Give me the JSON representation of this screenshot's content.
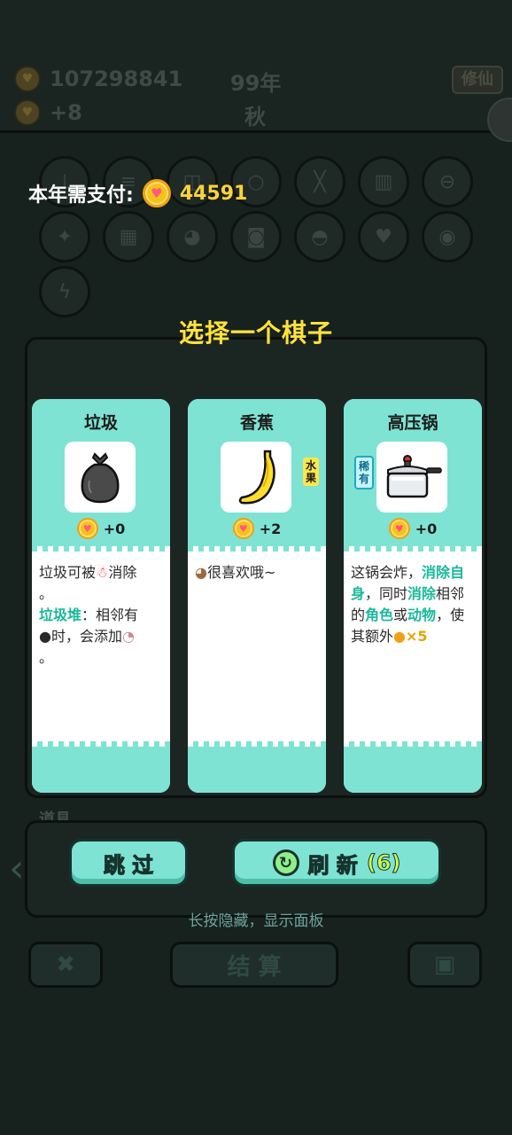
{
  "header": {
    "gold": "107298841",
    "income": "+8",
    "year": "99年",
    "season": "秋",
    "xiuxian_label": "修仙"
  },
  "overlay": {
    "pay_label": "本年需支付:",
    "pay_amount": "44591",
    "choose_title": "选择一个棋子",
    "hint": "长按隐藏，显示面板"
  },
  "cards": [
    {
      "title": "垃圾",
      "item_icon": "garbage-bag-icon",
      "value": "+0",
      "desc_line1_a": "垃圾可被",
      "desc_line1_b": "消除",
      "desc_line1_c": "。",
      "desc_line2_hl": "垃圾堆",
      "desc_line2_a": "：相邻有",
      "desc_line2_b": "时，会添加",
      "desc_line2_c": "。"
    },
    {
      "title": "香蕉",
      "item_icon": "banana-icon",
      "value": "+2",
      "tag": "水果",
      "desc": "很喜欢哦~"
    },
    {
      "title": "高压锅",
      "item_icon": "pressure-cooker-icon",
      "value": "+0",
      "tag": "稀有",
      "desc_a": "这锅会炸，",
      "desc_b": "消除自身",
      "desc_c": "，同时",
      "desc_d": "消除",
      "desc_e": "相邻的",
      "desc_f": "角色",
      "desc_g": "或",
      "desc_h": "动物",
      "desc_i": "，使其额外",
      "desc_j": "×5"
    }
  ],
  "buttons": {
    "skip": "跳 过",
    "refresh": "刷 新",
    "refresh_count": "(6)"
  },
  "bottom": {
    "tools_label": "道具",
    "settle": "结 算"
  },
  "colors": {
    "card_accent": "#7ee3d3",
    "title_yellow": "#ffe23d",
    "coin_gold": "#f6c21a",
    "highlight_teal": "#19b89a"
  }
}
